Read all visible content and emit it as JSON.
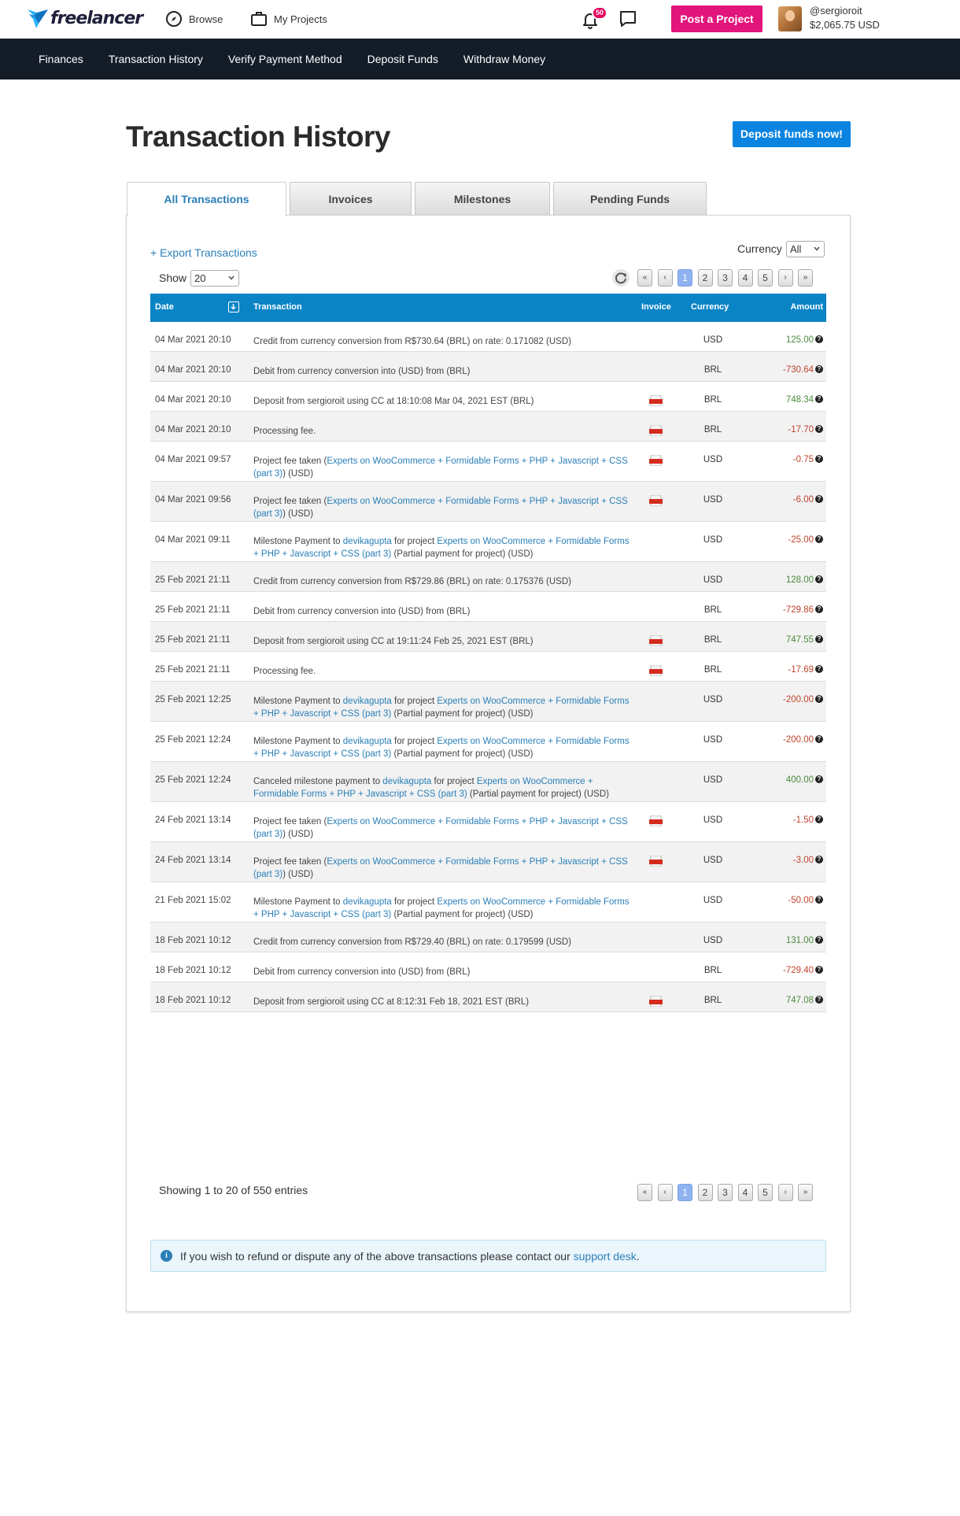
{
  "header": {
    "logo_text": "freelancer",
    "browse_label": "Browse",
    "projects_label": "My Projects",
    "notification_count": "50",
    "post_project_label": "Post a Project",
    "username": "@sergioroit",
    "balance": "$2,065.75 USD"
  },
  "subnav": {
    "items": [
      "Finances",
      "Transaction History",
      "Verify Payment Method",
      "Deposit Funds",
      "Withdraw Money"
    ]
  },
  "page": {
    "title": "Transaction History",
    "deposit_button": "Deposit funds now!"
  },
  "tabs": [
    "All Transactions",
    "Invoices",
    "Milestones",
    "Pending Funds"
  ],
  "controls": {
    "export_label": "+ Export Transactions",
    "currency_label": "Currency",
    "currency_value": "All",
    "show_label": "Show",
    "show_value": "20"
  },
  "pagination": {
    "first": "«",
    "prev": "‹",
    "pages": [
      "1",
      "2",
      "3",
      "4",
      "5"
    ],
    "current": "1",
    "next": "›",
    "last": "»"
  },
  "table": {
    "columns": {
      "date": "Date",
      "transaction": "Transaction",
      "invoice": "Invoice",
      "currency": "Currency",
      "amount": "Amount"
    },
    "rows": [
      {
        "date": "04 Mar 2021 20:10",
        "parts": [
          [
            "Credit from currency conversion from R$730.64 (BRL) on rate: 0.171082 (USD)",
            0
          ]
        ],
        "invoice": false,
        "currency": "USD",
        "amount": "125.00",
        "sign": "pos",
        "h": 38
      },
      {
        "date": "04 Mar 2021 20:10",
        "parts": [
          [
            "Debit from currency conversion into (USD) from (BRL)",
            0
          ]
        ],
        "invoice": false,
        "currency": "BRL",
        "amount": "-730.64",
        "sign": "neg",
        "h": 38
      },
      {
        "date": "04 Mar 2021 20:10",
        "parts": [
          [
            "Deposit from sergioroit using CC at 18:10:08 Mar 04, 2021 EST (BRL)",
            0
          ]
        ],
        "invoice": true,
        "currency": "BRL",
        "amount": "748.34",
        "sign": "pos",
        "h": 38
      },
      {
        "date": "04 Mar 2021 20:10",
        "parts": [
          [
            "Processing fee.",
            0
          ]
        ],
        "invoice": true,
        "currency": "BRL",
        "amount": "-17.70",
        "sign": "neg",
        "h": 38
      },
      {
        "date": "04 Mar 2021 09:57",
        "parts": [
          [
            "Project fee taken (",
            0
          ],
          [
            "Experts on WooCommerce + Formidable Forms + PHP + Javascript + CSS (part 3)",
            1
          ],
          [
            ") (USD)",
            0
          ]
        ],
        "invoice": true,
        "currency": "USD",
        "amount": "-0.75",
        "sign": "neg",
        "h": 51
      },
      {
        "date": "04 Mar 2021 09:56",
        "parts": [
          [
            "Project fee taken (",
            0
          ],
          [
            "Experts on WooCommerce + Formidable Forms + PHP + Javascript + CSS (part 3)",
            1
          ],
          [
            ") (USD)",
            0
          ]
        ],
        "invoice": true,
        "currency": "USD",
        "amount": "-6.00",
        "sign": "neg",
        "h": 51
      },
      {
        "date": "04 Mar 2021 09:11",
        "parts": [
          [
            "Milestone Payment to ",
            0
          ],
          [
            "devikagupta",
            1
          ],
          [
            " for project ",
            0
          ],
          [
            "Experts on WooCommerce + Formidable Forms + PHP + Javascript + CSS (part 3)",
            1
          ],
          [
            " (Partial payment for project) (USD)",
            0
          ]
        ],
        "invoice": false,
        "currency": "USD",
        "amount": "-25.00",
        "sign": "neg",
        "h": 51
      },
      {
        "date": "25 Feb 2021 21:11",
        "parts": [
          [
            "Credit from currency conversion from R$729.86 (BRL) on rate: 0.175376 (USD)",
            0
          ]
        ],
        "invoice": false,
        "currency": "USD",
        "amount": "128.00",
        "sign": "pos",
        "h": 38
      },
      {
        "date": "25 Feb 2021 21:11",
        "parts": [
          [
            "Debit from currency conversion into (USD) from (BRL)",
            0
          ]
        ],
        "invoice": false,
        "currency": "BRL",
        "amount": "-729.86",
        "sign": "neg",
        "h": 38
      },
      {
        "date": "25 Feb 2021 21:11",
        "parts": [
          [
            "Deposit from sergioroit using CC at 19:11:24 Feb 25, 2021 EST (BRL)",
            0
          ]
        ],
        "invoice": true,
        "currency": "BRL",
        "amount": "747.55",
        "sign": "pos",
        "h": 38
      },
      {
        "date": "25 Feb 2021 21:11",
        "parts": [
          [
            "Processing fee.",
            0
          ]
        ],
        "invoice": true,
        "currency": "BRL",
        "amount": "-17.69",
        "sign": "neg",
        "h": 38
      },
      {
        "date": "25 Feb 2021 12:25",
        "parts": [
          [
            "Milestone Payment to ",
            0
          ],
          [
            "devikagupta",
            1
          ],
          [
            " for project ",
            0
          ],
          [
            "Experts on WooCommerce + Formidable Forms + PHP + Javascript + CSS (part 3)",
            1
          ],
          [
            " (Partial payment for project) (USD)",
            0
          ]
        ],
        "invoice": false,
        "currency": "USD",
        "amount": "-200.00",
        "sign": "neg",
        "h": 51
      },
      {
        "date": "25 Feb 2021 12:24",
        "parts": [
          [
            "Milestone Payment to ",
            0
          ],
          [
            "devikagupta",
            1
          ],
          [
            " for project ",
            0
          ],
          [
            "Experts on WooCommerce + Formidable Forms + PHP + Javascript + CSS (part 3)",
            1
          ],
          [
            " (Partial payment for project) (USD)",
            0
          ]
        ],
        "invoice": false,
        "currency": "USD",
        "amount": "-200.00",
        "sign": "neg",
        "h": 51
      },
      {
        "date": "25 Feb 2021 12:24",
        "parts": [
          [
            "Canceled milestone payment to ",
            0
          ],
          [
            "devikagupta",
            1
          ],
          [
            " for project ",
            0
          ],
          [
            "Experts on WooCommerce + Formidable Forms + PHP + Javascript + CSS (part 3)",
            1
          ],
          [
            " (Partial payment for project) (USD)",
            0
          ]
        ],
        "invoice": false,
        "currency": "USD",
        "amount": "400.00",
        "sign": "pos",
        "h": 51
      },
      {
        "date": "24 Feb 2021 13:14",
        "parts": [
          [
            "Project fee taken (",
            0
          ],
          [
            "Experts on WooCommerce + Formidable Forms + PHP + Javascript + CSS (part 3)",
            1
          ],
          [
            ") (USD)",
            0
          ]
        ],
        "invoice": true,
        "currency": "USD",
        "amount": "-1.50",
        "sign": "neg",
        "h": 51
      },
      {
        "date": "24 Feb 2021 13:14",
        "parts": [
          [
            "Project fee taken (",
            0
          ],
          [
            "Experts on WooCommerce + Formidable Forms + PHP + Javascript + CSS (part 3)",
            1
          ],
          [
            ") (USD)",
            0
          ]
        ],
        "invoice": true,
        "currency": "USD",
        "amount": "-3.00",
        "sign": "neg",
        "h": 51
      },
      {
        "date": "21 Feb 2021 15:02",
        "parts": [
          [
            "Milestone Payment to ",
            0
          ],
          [
            "devikagupta",
            1
          ],
          [
            " for project ",
            0
          ],
          [
            "Experts on WooCommerce + Formidable Forms + PHP + Javascript + CSS (part 3)",
            1
          ],
          [
            " (Partial payment for project) (USD)",
            0
          ]
        ],
        "invoice": false,
        "currency": "USD",
        "amount": "-50.00",
        "sign": "neg",
        "h": 51
      },
      {
        "date": "18 Feb 2021 10:12",
        "parts": [
          [
            "Credit from currency conversion from R$729.40 (BRL) on rate: 0.179599 (USD)",
            0
          ]
        ],
        "invoice": false,
        "currency": "USD",
        "amount": "131.00",
        "sign": "pos",
        "h": 38
      },
      {
        "date": "18 Feb 2021 10:12",
        "parts": [
          [
            "Debit from currency conversion into (USD) from (BRL)",
            0
          ]
        ],
        "invoice": false,
        "currency": "BRL",
        "amount": "-729.40",
        "sign": "neg",
        "h": 38
      },
      {
        "date": "18 Feb 2021 10:12",
        "parts": [
          [
            "Deposit from sergioroit using CC at 8:12:31 Feb 18, 2021 EST (BRL)",
            0
          ]
        ],
        "invoice": true,
        "currency": "BRL",
        "amount": "747.08",
        "sign": "pos",
        "h": 38
      }
    ]
  },
  "footer": {
    "showing_text": "Showing 1 to 20 of 550 entries",
    "info_text": "If you wish to refund or dispute any of the above transactions please contact our ",
    "info_link": "support desk",
    "info_end": "."
  },
  "colors": {
    "brand_pink": "#e1157b",
    "primary_blue": "#0a84e0",
    "table_header": "#0b84c6",
    "link": "#2a7fb8",
    "positive": "#4c8a3c",
    "negative": "#c1442d"
  },
  "icons": [
    "freelancer-logo",
    "compass-icon",
    "briefcase-icon",
    "bell-icon",
    "chat-icon",
    "refresh-icon",
    "sort-icon",
    "pdf-icon",
    "help-icon",
    "info-icon",
    "chevron-down-icon"
  ]
}
